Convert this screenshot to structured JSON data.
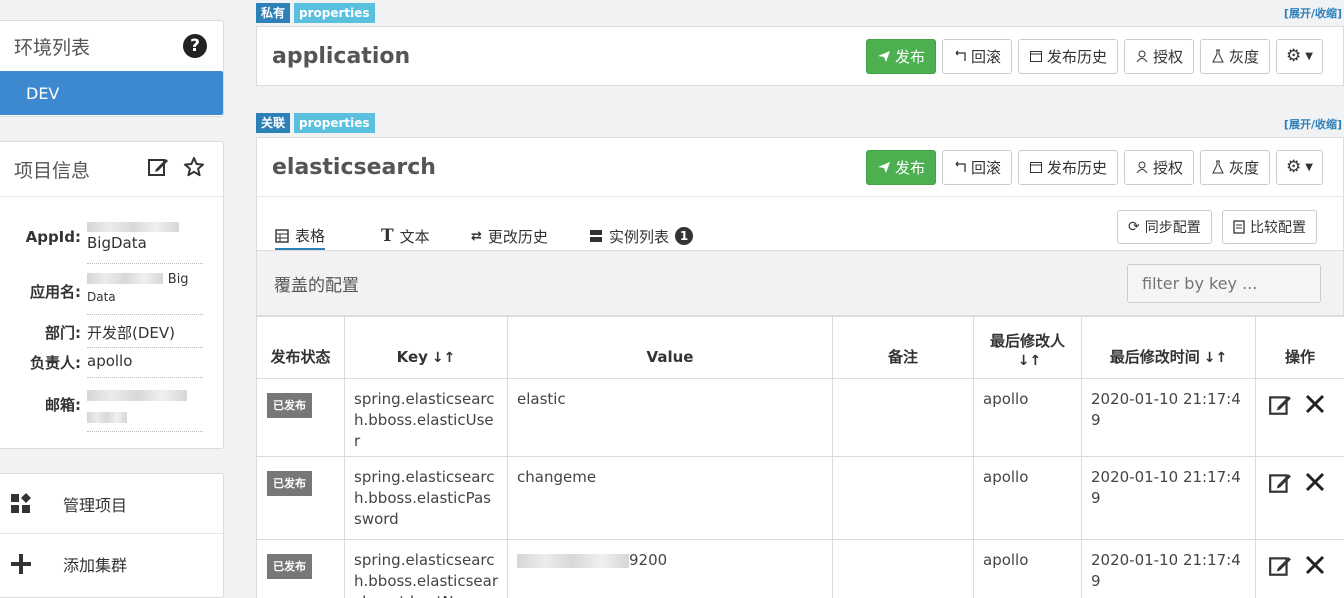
{
  "sidebar": {
    "env_title": "环境列表",
    "env_active": "DEV",
    "info_title": "项目信息",
    "fields": [
      {
        "label": "AppId:",
        "value": "BigData"
      },
      {
        "label": "应用名:",
        "value": "Big",
        "value2": "Data"
      },
      {
        "label": "部门:",
        "value": "开发部(DEV)"
      },
      {
        "label": "负责人:",
        "value": "apollo"
      },
      {
        "label": "邮箱:",
        "value": ""
      }
    ],
    "nav": [
      {
        "label": "管理项目",
        "icon": "apps-icon"
      },
      {
        "label": "添加集群",
        "icon": "plus-icon"
      }
    ]
  },
  "namespaces": [
    {
      "tag1": "私有",
      "tag2": "properties",
      "expand": "[展开/收缩]",
      "name": "application"
    },
    {
      "tag1": "关联",
      "tag2": "properties",
      "expand": "[展开/收缩]",
      "name": "elasticsearch"
    }
  ],
  "buttons": {
    "publish": "发布",
    "rollback": "回滚",
    "history": "发布历史",
    "grant": "授权",
    "gray": "灰度"
  },
  "tabs": {
    "table": "表格",
    "text": "文本",
    "history": "更改历史",
    "instances": "实例列表",
    "instances_count": "1",
    "sync": "同步配置",
    "compare": "比较配置"
  },
  "override": {
    "title": "覆盖的配置",
    "filter_placeholder": "filter by key ..."
  },
  "table": {
    "headers": {
      "status": "发布状态",
      "key": "Key",
      "value": "Value",
      "comment": "备注",
      "modifier": "最后修改人",
      "time": "最后修改时间",
      "ops": "操作"
    },
    "rows": [
      {
        "status": "已发布",
        "key": "spring.elasticsearch.bboss.elasticUser",
        "value": "elastic",
        "comment": "",
        "modifier": "apollo",
        "time": "2020-01-10 21:17:49"
      },
      {
        "status": "已发布",
        "key": "spring.elasticsearch.bboss.elasticPassword",
        "value": "changeme",
        "comment": "",
        "modifier": "apollo",
        "time": "2020-01-10 21:17:49"
      },
      {
        "status": "已发布",
        "key": "spring.elasticsearch.bboss.elasticsearch.rest.hostNames",
        "value": "9200",
        "comment": "",
        "modifier": "apollo",
        "time": "2020-01-10 21:17:49"
      }
    ]
  }
}
